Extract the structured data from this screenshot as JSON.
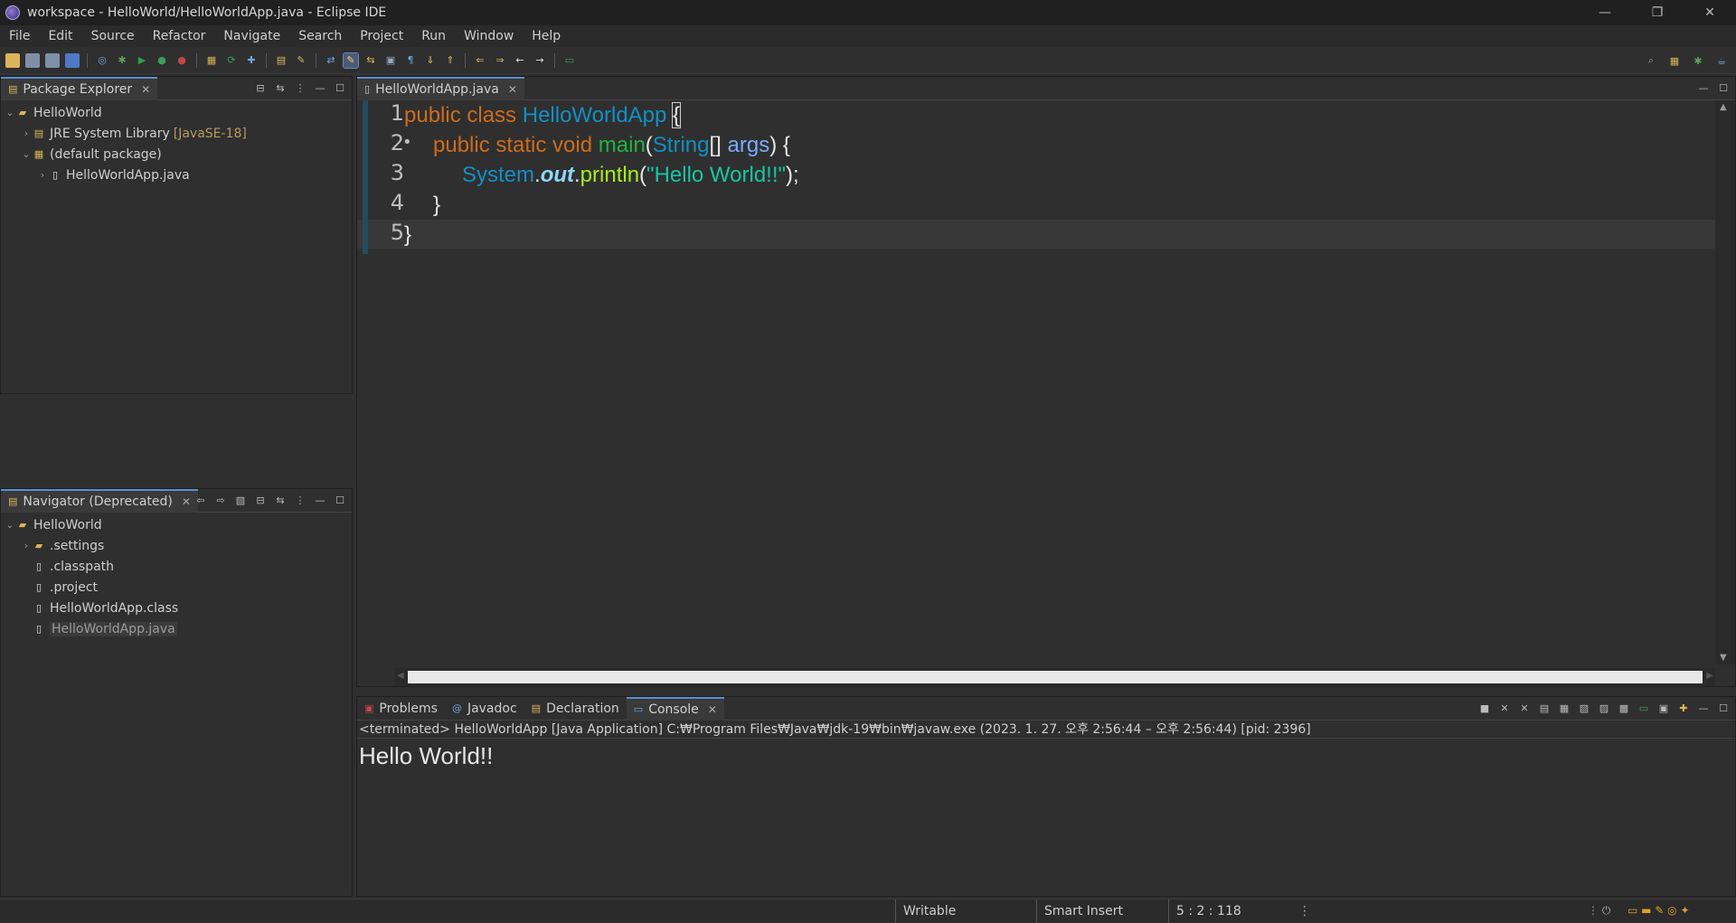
{
  "window": {
    "title": "workspace - HelloWorld/HelloWorldApp.java - Eclipse IDE",
    "controls": [
      "—",
      "❐",
      "✕"
    ]
  },
  "menu": [
    "File",
    "Edit",
    "Source",
    "Refactor",
    "Navigate",
    "Search",
    "Project",
    "Run",
    "Window",
    "Help"
  ],
  "package_explorer": {
    "tab_label": "Package Explorer",
    "nodes": [
      {
        "label": "HelloWorld",
        "decoration": "",
        "icon": "project-icon",
        "expanded": "⌄"
      },
      {
        "label": "JRE System Library",
        "decoration": "[JavaSE-18]",
        "icon": "library-icon",
        "expanded": "›"
      },
      {
        "label": "(default package)",
        "decoration": "",
        "icon": "package-icon",
        "expanded": "⌄"
      },
      {
        "label": "HelloWorldApp.java",
        "decoration": "",
        "icon": "java-file-icon",
        "expanded": "›"
      }
    ]
  },
  "navigator": {
    "tab_label": "Navigator (Deprecated)",
    "nodes": [
      {
        "label": "HelloWorld",
        "icon": "project-icon",
        "expanded": "⌄"
      },
      {
        "label": ".settings",
        "icon": "folder-icon",
        "expanded": "›"
      },
      {
        "label": ".classpath",
        "icon": "file-icon"
      },
      {
        "label": ".project",
        "icon": "file-icon"
      },
      {
        "label": "HelloWorldApp.class",
        "icon": "class-file-icon"
      },
      {
        "label": "HelloWorldApp.java",
        "icon": "java-file-icon",
        "selected": true
      }
    ]
  },
  "editor": {
    "tab_label": "HelloWorldApp.java",
    "line_numbers": [
      "1",
      "2",
      "3",
      "4",
      "5"
    ],
    "line2_marker": "•",
    "code": {
      "l1_kw": "public class ",
      "l1_cls": "HelloWorldApp",
      "l1_brace": "{",
      "l2_kw": "public static void ",
      "l2_fn": "main",
      "l2_p1": "(",
      "l2_type": "String",
      "l2_p2": "[] ",
      "l2_var": "args",
      "l2_p3": ") {",
      "l3_sys": "System",
      "l3_dot1": ".",
      "l3_out": "out",
      "l3_dot2": ".",
      "l3_mth": "println",
      "l3_p1": "(",
      "l3_str": "\"Hello World!!\"",
      "l3_p2": ");",
      "l4": "}",
      "l5": "}"
    }
  },
  "bottom_panel": {
    "tabs": [
      "Problems",
      "Javadoc",
      "Declaration",
      "Console"
    ],
    "console_header": "<terminated> HelloWorldApp [Java Application] C:₩Program Files₩Java₩jdk-19₩bin₩javaw.exe  (2023. 1. 27. 오후 2:56:44 – 오후 2:56:44) [pid: 2396]",
    "console_output": "Hello World!!"
  },
  "status": {
    "writable": "Writable",
    "insert_mode": "Smart Insert",
    "position": "5 : 2 : 118"
  },
  "colors": {
    "keyword": "#cc6c1d",
    "class": "#1290c3",
    "method_decl": "#1eb540",
    "string": "#17c6a3"
  }
}
